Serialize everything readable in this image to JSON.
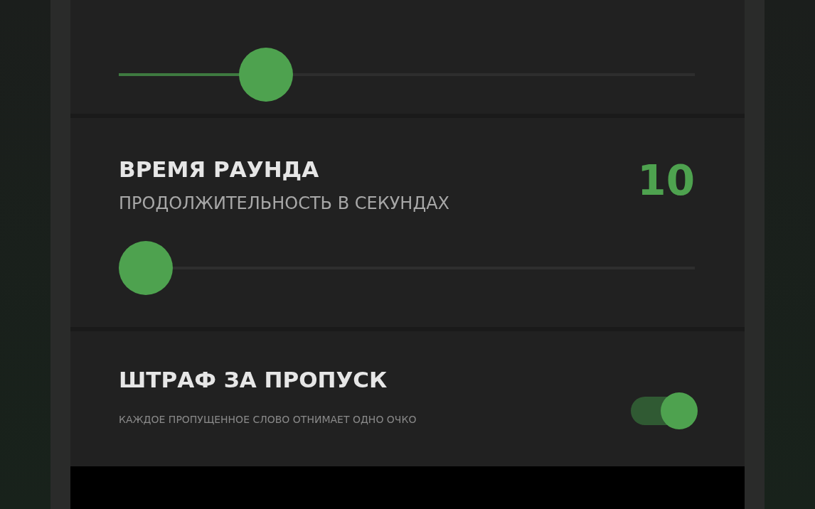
{
  "settings": [
    {
      "kind": "slider",
      "level": 0.23
    },
    {
      "kind": "slider",
      "title": "ВРЕМЯ РАУНДА",
      "subtitle": "ПРОДОЛЖИТЕЛЬНОСТЬ В СЕКУНДАХ",
      "value": "10",
      "level": 0
    },
    {
      "kind": "toggle",
      "title": "ШТРАФ ЗА ПРОПУСК",
      "subtitle": "КАЖДОЕ ПРОПУЩЕННОЕ СЛОВО ОТНИМАЕТ ОДНО ОЧКО",
      "on": true
    }
  ]
}
